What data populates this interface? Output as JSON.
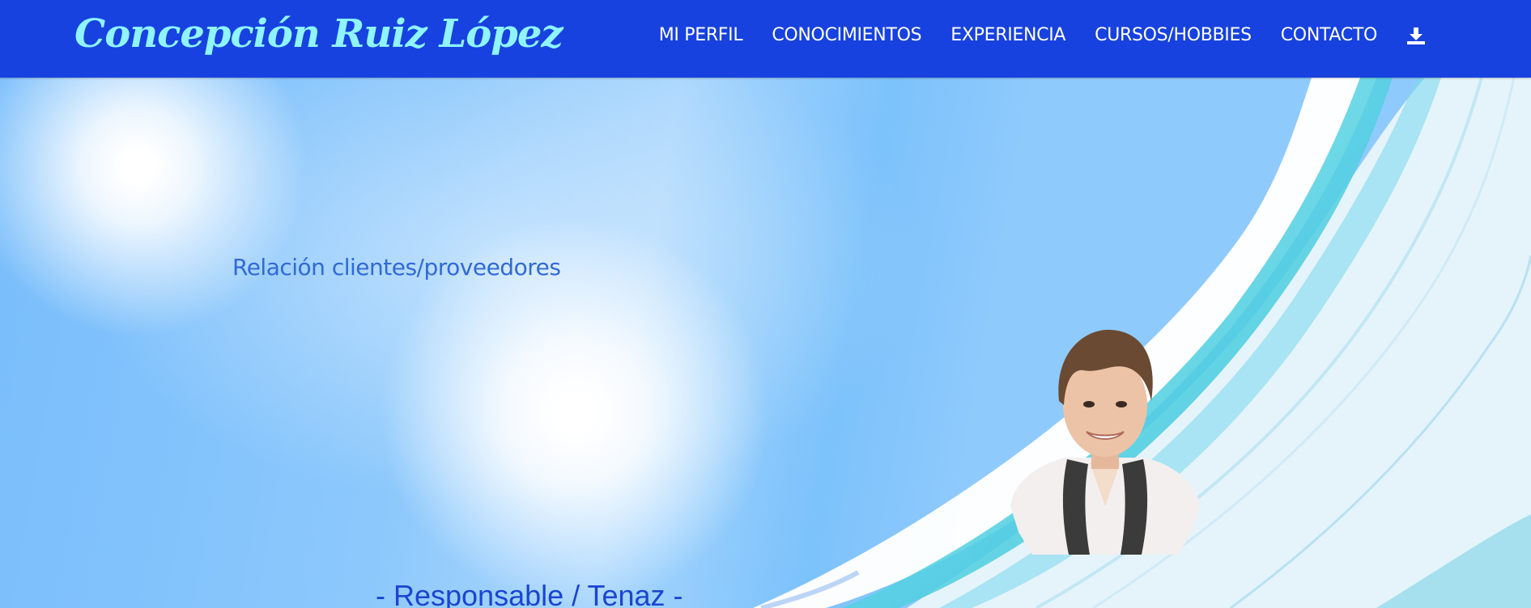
{
  "brand": {
    "name": "Concepción Ruiz López",
    "color": "#8ff4ff"
  },
  "navbar": {
    "background": "#1742df",
    "links": [
      {
        "label": "MI PERFIL"
      },
      {
        "label": "CONOCIMIENTOS"
      },
      {
        "label": "EXPERIENCIA"
      },
      {
        "label": "CURSOS/HOBBIES"
      },
      {
        "label": "CONTACTO"
      }
    ],
    "download_icon": "download-icon"
  },
  "hero": {
    "tagline": "Relación clientes/proveedores",
    "motto": "- Responsable / Tenaz -",
    "portrait_icon": "profile-photo"
  }
}
